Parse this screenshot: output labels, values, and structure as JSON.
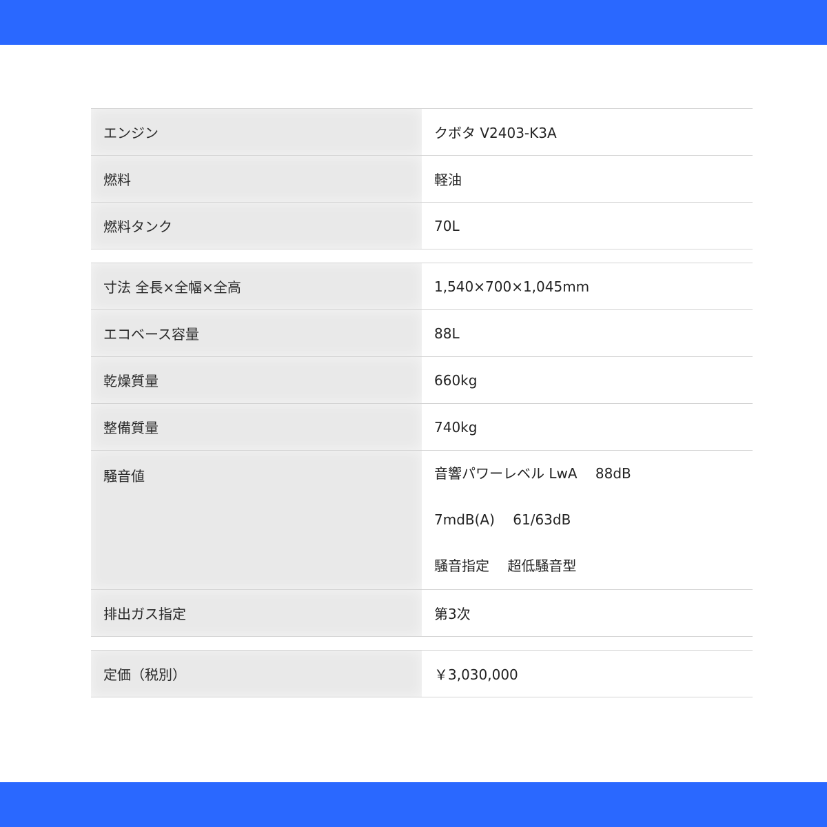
{
  "tables": [
    {
      "rows": [
        {
          "label": "エンジン",
          "value": "クボタ V2403-K3A"
        },
        {
          "label": "燃料",
          "value": "軽油"
        },
        {
          "label": "燃料タンク",
          "value": "70L"
        }
      ]
    },
    {
      "rows": [
        {
          "label": "寸法 全長×全幅×全高",
          "value": "1,540×700×1,045mm"
        },
        {
          "label": "エコベース容量",
          "value": "88L"
        },
        {
          "label": "乾燥質量",
          "value": "660kg"
        },
        {
          "label": "整備質量",
          "value": "740kg"
        },
        {
          "label": "騒音値",
          "values": [
            "音響パワーレベル LwA　 88dB",
            "7mdB(A)　 61/63dB",
            "騒音指定　 超低騒音型"
          ]
        },
        {
          "label": "排出ガス指定",
          "value": "第3次"
        }
      ]
    },
    {
      "rows": [
        {
          "label": "定価（税別）",
          "value": "￥3,030,000"
        }
      ]
    }
  ],
  "colors": {
    "header_bar": "#2a68ff",
    "label_cell_bg": "#e9e9e9",
    "row_border": "#d4d4d4"
  }
}
